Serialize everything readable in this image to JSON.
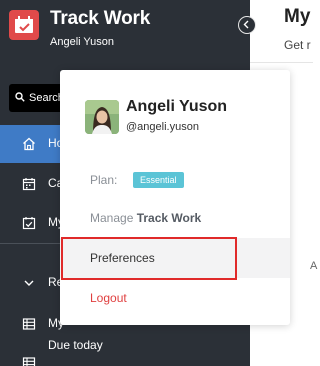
{
  "sidebar": {
    "app_name": "Track Work",
    "user_name": "Angeli Yuson",
    "search": {
      "placeholder": "Search"
    },
    "nav": [
      {
        "label": "Home",
        "icon": "home-icon",
        "active": true
      },
      {
        "label": "Calendar",
        "icon": "calendar-icon"
      },
      {
        "label": "My Tasks",
        "icon": "task-icon"
      },
      {
        "label": "Reports",
        "icon": "chevron-down-icon"
      },
      {
        "label": "My",
        "icon": "table-icon"
      },
      {
        "label": "Due today",
        "icon": "table-icon"
      }
    ]
  },
  "main": {
    "title": "My",
    "subtitle": "Get r",
    "partial_text": "A"
  },
  "popup": {
    "name": "Angeli Yuson",
    "handle": "@angeli.yuson",
    "plan_label": "Plan:",
    "plan_value": "Essential",
    "manage_prefix": "Manage",
    "manage_app": "Track Work",
    "preferences": "Preferences",
    "logout": "Logout"
  },
  "colors": {
    "sidebar_bg": "#2b3037",
    "active_nav": "#3f7bc6",
    "brand_red": "#e04a4a",
    "plan_badge": "#5bc4d6",
    "logout_red": "#e04040",
    "highlight_border": "#e02a2a"
  }
}
